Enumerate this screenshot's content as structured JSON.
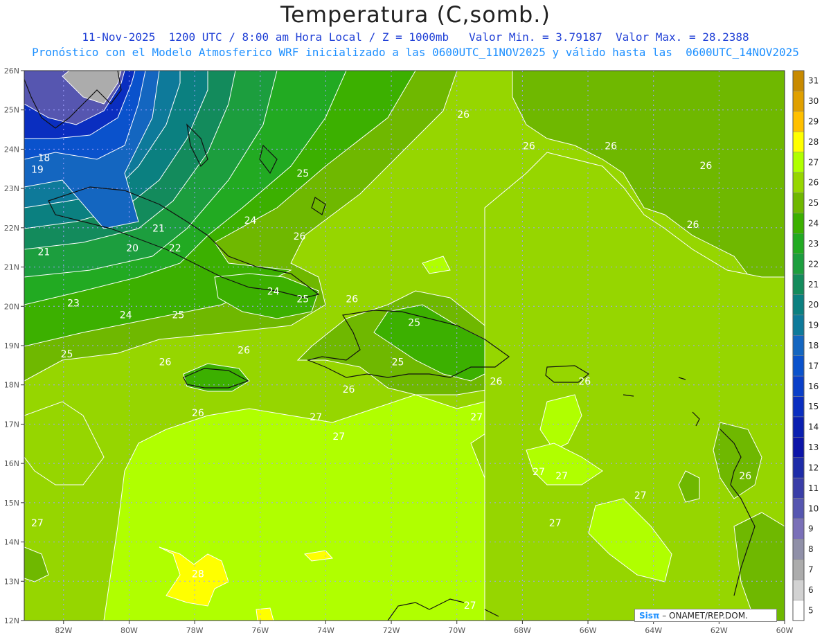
{
  "header": {
    "title": "Temperatura (C,somb.)",
    "subtitle_1": "11-Nov-2025  1200 UTC / 8:00 am Hora Local / Z = 1000mb   Valor Min. = 3.79187  Valor Max. = 28.2388",
    "subtitle_2": "Pronóstico con el Modelo Atmosferico WRF inicializado a las 0600UTC_11NOV2025 y válido hasta las  0600UTC_14NOV2025"
  },
  "map": {
    "lon_range": [
      -83.2,
      -60
    ],
    "lat_range": [
      12,
      26
    ],
    "lon_ticks": [
      "82W",
      "80W",
      "78W",
      "76W",
      "74W",
      "72W",
      "70W",
      "68W",
      "66W",
      "64W",
      "62W",
      "60W"
    ],
    "lat_ticks": [
      "12N",
      "13N",
      "14N",
      "15N",
      "16N",
      "17N",
      "18N",
      "19N",
      "20N",
      "21N",
      "22N",
      "23N",
      "24N",
      "25N",
      "26N"
    ],
    "contour_labels": [
      {
        "text": "18",
        "lon": -82.6,
        "lat": 23.7
      },
      {
        "text": "19",
        "lon": -82.8,
        "lat": 23.4
      },
      {
        "text": "20",
        "lon": -79.9,
        "lat": 21.4
      },
      {
        "text": "21",
        "lon": -82.6,
        "lat": 21.3
      },
      {
        "text": "21",
        "lon": -79.1,
        "lat": 21.9
      },
      {
        "text": "22",
        "lon": -78.6,
        "lat": 21.4
      },
      {
        "text": "23",
        "lon": -81.7,
        "lat": 20.0
      },
      {
        "text": "24",
        "lon": -80.1,
        "lat": 19.7
      },
      {
        "text": "24",
        "lon": -76.3,
        "lat": 22.1
      },
      {
        "text": "24",
        "lon": -75.6,
        "lat": 20.3
      },
      {
        "text": "25",
        "lon": -81.9,
        "lat": 18.7
      },
      {
        "text": "25",
        "lon": -78.5,
        "lat": 19.7
      },
      {
        "text": "25",
        "lon": -74.7,
        "lat": 20.1
      },
      {
        "text": "25",
        "lon": -74.7,
        "lat": 23.3
      },
      {
        "text": "25",
        "lon": -71.3,
        "lat": 19.5
      },
      {
        "text": "25",
        "lon": -71.8,
        "lat": 18.5
      },
      {
        "text": "26",
        "lon": -74.8,
        "lat": 21.7
      },
      {
        "text": "26",
        "lon": -73.2,
        "lat": 20.1
      },
      {
        "text": "26",
        "lon": -78.9,
        "lat": 18.5
      },
      {
        "text": "26",
        "lon": -76.5,
        "lat": 18.8
      },
      {
        "text": "26",
        "lon": -73.3,
        "lat": 17.8
      },
      {
        "text": "26",
        "lon": -77.9,
        "lat": 17.2
      },
      {
        "text": "26",
        "lon": -68.8,
        "lat": 18.0
      },
      {
        "text": "26",
        "lon": -66.1,
        "lat": 18.0
      },
      {
        "text": "26",
        "lon": -69.8,
        "lat": 24.8
      },
      {
        "text": "26",
        "lon": -67.8,
        "lat": 24.0
      },
      {
        "text": "26",
        "lon": -65.3,
        "lat": 24.0
      },
      {
        "text": "26",
        "lon": -62.4,
        "lat": 23.5
      },
      {
        "text": "26",
        "lon": -62.8,
        "lat": 22.0
      },
      {
        "text": "26",
        "lon": -61.2,
        "lat": 15.6
      },
      {
        "text": "27",
        "lon": -74.3,
        "lat": 17.1
      },
      {
        "text": "27",
        "lon": -73.6,
        "lat": 16.6
      },
      {
        "text": "27",
        "lon": -69.4,
        "lat": 17.1
      },
      {
        "text": "27",
        "lon": -67.5,
        "lat": 15.7
      },
      {
        "text": "27",
        "lon": -66.8,
        "lat": 15.6
      },
      {
        "text": "27",
        "lon": -64.4,
        "lat": 15.1
      },
      {
        "text": "27",
        "lon": -67.0,
        "lat": 14.4
      },
      {
        "text": "27",
        "lon": -82.8,
        "lat": 14.4
      },
      {
        "text": "27",
        "lon": -69.6,
        "lat": 12.3
      },
      {
        "text": "28",
        "lon": -77.9,
        "lat": 13.1
      }
    ]
  },
  "colorbar": {
    "labels": [
      "31",
      "30",
      "29",
      "28",
      "27",
      "26",
      "25",
      "24",
      "23",
      "22",
      "21",
      "20",
      "19",
      "18",
      "17",
      "16",
      "15",
      "14",
      "13",
      "12",
      "11",
      "10",
      "9",
      "8",
      "7",
      "6",
      "5"
    ],
    "colors": [
      "#c88a00",
      "#e0a000",
      "#ffc000",
      "#ffff00",
      "#b0ff00",
      "#96d600",
      "#6fb800",
      "#3cb000",
      "#22aa22",
      "#1c9e3e",
      "#138b5c",
      "#0b8080",
      "#0e7a9a",
      "#1466c0",
      "#0a52cc",
      "#0a3fc8",
      "#0a2ec0",
      "#0a1fb0",
      "#0c14a8",
      "#1e2ca8",
      "#3a3ea8",
      "#5656b0",
      "#7a70b8",
      "#9090a8",
      "#acacac",
      "#d2d2d2",
      "#ffffff"
    ]
  },
  "credit": {
    "logo": "Sisπ",
    "text": " – ONAMET/REP.DOM."
  }
}
